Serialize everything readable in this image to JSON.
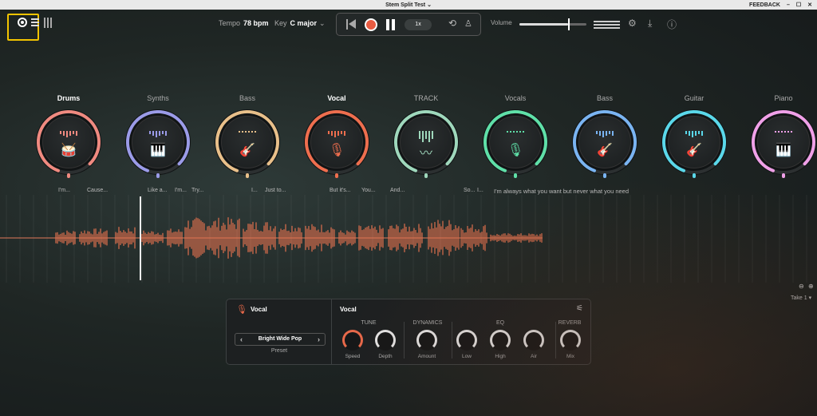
{
  "window": {
    "title": "Stem Split Test",
    "feedback": "FEEDBACK"
  },
  "toolbar": {
    "tempo_label": "Tempo",
    "tempo_value": "78 bpm",
    "key_label": "Key",
    "key_value": "C major",
    "speed": "1x",
    "volume_label": "Volume",
    "volume_level": 0.73
  },
  "stems": [
    {
      "name": "Drums",
      "bold": true,
      "color": "#f08a80",
      "icon": "drum-icon"
    },
    {
      "name": "Synths",
      "bold": false,
      "color": "#9b9be8",
      "icon": "keyboard-icon"
    },
    {
      "name": "Bass",
      "bold": false,
      "color": "#e9c08a",
      "icon": "bass-guitar-icon"
    },
    {
      "name": "Vocal",
      "bold": true,
      "color": "#ef6e4e",
      "icon": "microphone-icon"
    },
    {
      "name": "TRACK",
      "bold": false,
      "color": "#9fd8bc",
      "icon": "waveform-icon"
    },
    {
      "name": "Vocals",
      "bold": false,
      "color": "#5fe0a8",
      "icon": "microphone-icon"
    },
    {
      "name": "Bass",
      "bold": false,
      "color": "#7ab4f2",
      "icon": "bass-guitar-icon"
    },
    {
      "name": "Guitar",
      "bold": false,
      "color": "#5ad8ea",
      "icon": "guitar-icon"
    },
    {
      "name": "Piano",
      "bold": false,
      "color": "#f0a0e8",
      "icon": "keyboard-icon"
    }
  ],
  "lyrics": [
    {
      "text": "I'm..."
    },
    {
      "text": "Cause..."
    },
    {
      "text": "Like a..."
    },
    {
      "text": "I'm..."
    },
    {
      "text": "Try..."
    },
    {
      "text": "I..."
    },
    {
      "text": "Just to..."
    },
    {
      "text": "But it's..."
    },
    {
      "text": "You..."
    },
    {
      "text": "And..."
    },
    {
      "text": "So..."
    },
    {
      "text": "I..."
    },
    {
      "text": "I'm always what you want but never what you need"
    }
  ],
  "take": "Take 1",
  "panel": {
    "stem_title": "Vocal",
    "preset_value": "Bright Wide Pop",
    "preset_label": "Preset",
    "effects_title": "Vocal",
    "groups": [
      "TUNE",
      "DYNAMICS",
      "EQ",
      "REVERB"
    ],
    "knobs": [
      "Speed",
      "Depth",
      "Amount",
      "Low",
      "High",
      "Air",
      "Mix"
    ]
  },
  "colors": {
    "accent": "#e8694a",
    "highlight": "#f2c400"
  }
}
